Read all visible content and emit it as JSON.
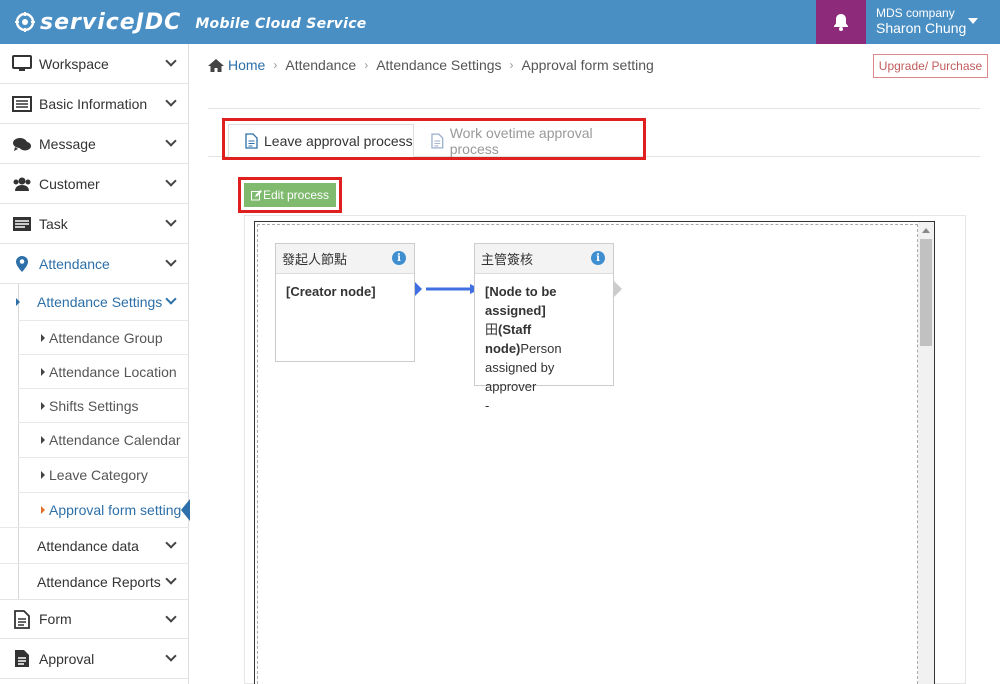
{
  "brand": {
    "logo_text": "serviceJDC",
    "tagline": "Mobile Cloud Service"
  },
  "user": {
    "company": "MDS company",
    "name": "Sharon Chung"
  },
  "sidebar": {
    "items": [
      {
        "label": "Workspace",
        "icon": "monitor-icon"
      },
      {
        "label": "Basic Information",
        "icon": "list-icon"
      },
      {
        "label": "Message",
        "icon": "chat-icon"
      },
      {
        "label": "Customer",
        "icon": "users-icon"
      },
      {
        "label": "Task",
        "icon": "task-icon"
      },
      {
        "label": "Attendance",
        "icon": "map-pin-icon"
      }
    ],
    "attendance_settings": "Attendance Settings",
    "sub_items": [
      "Attendance Group",
      "Attendance Location",
      "Shifts Settings",
      "Attendance Calendar",
      "Leave Category",
      "Approval form setting"
    ],
    "attendance_data": "Attendance data",
    "attendance_reports": "Attendance Reports",
    "bottom_items": [
      {
        "label": "Form",
        "icon": "document-icon"
      },
      {
        "label": "Approval",
        "icon": "approval-icon"
      }
    ]
  },
  "breadcrumb": {
    "home": "Home",
    "items": [
      "Attendance",
      "Attendance Settings",
      "Approval form setting"
    ]
  },
  "upgrade_label": "Upgrade/ Purchase",
  "tabs": [
    {
      "label": "Leave approval process",
      "active": true
    },
    {
      "label": "Work ovetime approval process",
      "active": false
    }
  ],
  "edit_button": "Edit process",
  "nodes": [
    {
      "title": "發起人節點",
      "body_bold": "[Creator node]"
    },
    {
      "title": "主管簽核",
      "body_bold": "[Node to be assigned]",
      "body_staff_prefix": "田",
      "body_staff_bold": "(Staff node)",
      "body_staff_rest": "Person assigned by approver",
      "body_tail": "-"
    }
  ],
  "colors": {
    "header": "#4a8fc4",
    "bell_bg": "#8e2a7a",
    "accent": "#2d6fa8",
    "edit_green": "#7fba6e",
    "highlight_red": "#e0201f"
  }
}
